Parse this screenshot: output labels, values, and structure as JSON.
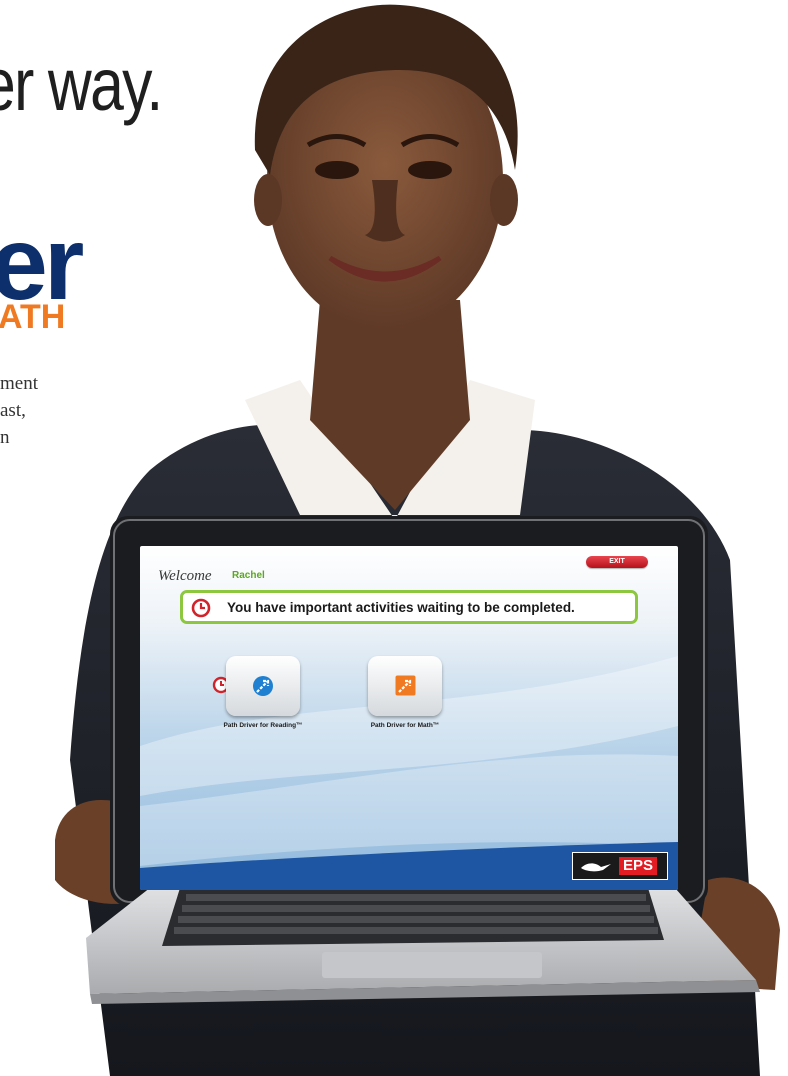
{
  "marketing": {
    "headline": "er way.",
    "logo_big": "er",
    "logo_sub": "ATH",
    "body_lines": [
      "ment",
      "ast,",
      "n"
    ]
  },
  "screen": {
    "welcome_label": "Welcome",
    "user_name": "Rachel",
    "exit_label": "EXIT",
    "alert_message": "You have important activities waiting to be completed.",
    "apps": [
      {
        "label": "Path Driver for Reading™",
        "icon": "reading-arrow-icon",
        "has_alert": true
      },
      {
        "label": "Path Driver for Math™",
        "icon": "math-arrow-icon",
        "has_alert": false
      }
    ],
    "brand": "EPS"
  },
  "colors": {
    "navy": "#0d2f6b",
    "orange": "#f07a22",
    "alert_border": "#8dc63f",
    "exit_red": "#c8202a",
    "reading_blue": "#1f7fd0",
    "math_orange": "#f07a22"
  }
}
